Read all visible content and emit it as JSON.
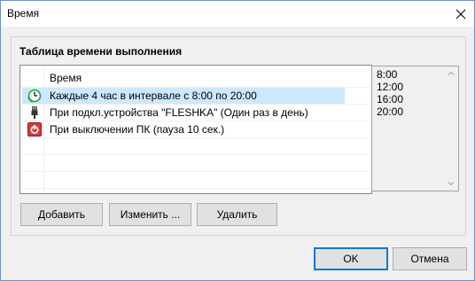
{
  "window": {
    "title": "Время"
  },
  "group": {
    "title": "Таблица времени выполнения"
  },
  "list": {
    "column_header": "Время",
    "rows": [
      {
        "icon": "clock-icon",
        "text": "Каждые 4 час в интервале с 8:00 по 20:00",
        "selected": true
      },
      {
        "icon": "usb-plug-icon",
        "text": "При подкл.устройства \"FLESHKA\" (Один раз в день)",
        "selected": false
      },
      {
        "icon": "power-off-icon",
        "text": "При выключении ПК (пауза 10 сек.)",
        "selected": false
      }
    ]
  },
  "times": [
    "8:00",
    "12:00",
    "16:00",
    "20:00"
  ],
  "buttons": {
    "add": "Добавить",
    "edit": "Изменить ...",
    "delete": "Удалить",
    "ok": "OK",
    "cancel": "Отмена"
  },
  "colors": {
    "selection": "#cce8ff",
    "default_button_border": "#0078d7",
    "power_icon": "#d9363e",
    "clock_icon": "#2e9e3e"
  }
}
